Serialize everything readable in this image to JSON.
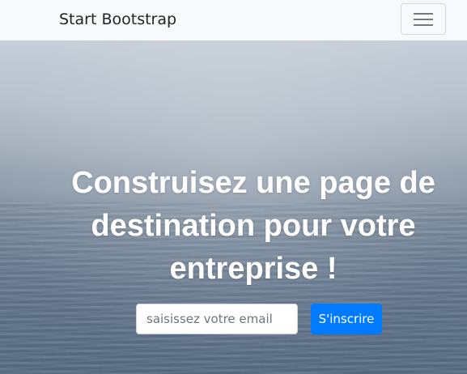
{
  "navbar": {
    "brand": "Start Bootstrap",
    "toggler_icon": "hamburger-menu-icon",
    "background": "#f8f9fa"
  },
  "hero": {
    "heading": "Construisez une page de destination pour votre entreprise !",
    "email_input": {
      "value": "",
      "placeholder": "saisissez votre email"
    },
    "submit_label": "S'inscrire",
    "accent_color": "#007bff"
  }
}
